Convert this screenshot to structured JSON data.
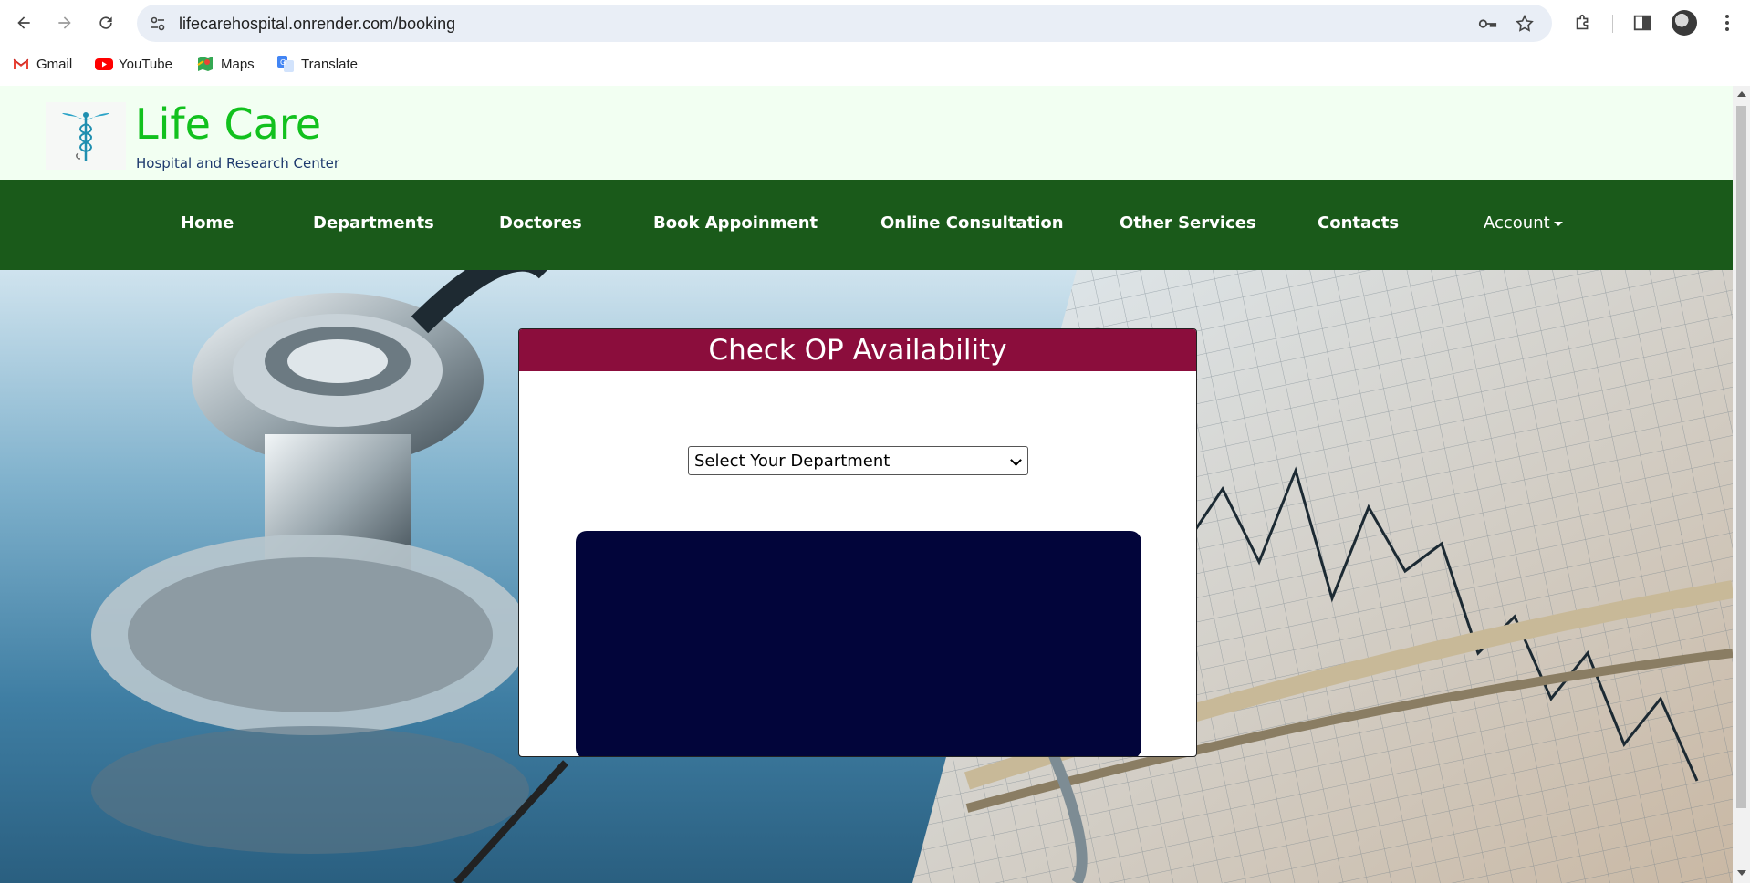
{
  "browser": {
    "url": "lifecarehospital.onrender.com/booking",
    "bookmarks": [
      {
        "label": "Gmail",
        "icon": "gmail-icon"
      },
      {
        "label": "YouTube",
        "icon": "youtube-icon"
      },
      {
        "label": "Maps",
        "icon": "maps-icon"
      },
      {
        "label": "Translate",
        "icon": "translate-icon"
      }
    ]
  },
  "site": {
    "brand": "Life Care",
    "tagline": "Hospital and Research Center",
    "colors": {
      "brand_green": "#12c11e",
      "nav_bg": "#1a5a1a",
      "card_header": "#8b0d3c",
      "panel_navy": "#02053a"
    }
  },
  "nav": {
    "items": [
      "Home",
      "Departments",
      "Doctores",
      "Book Appoinment",
      "Online Consultation",
      "Other Services",
      "Contacts"
    ],
    "account": "Account"
  },
  "booking": {
    "title": "Check OP Availability",
    "department_select": "Select Your Department"
  }
}
